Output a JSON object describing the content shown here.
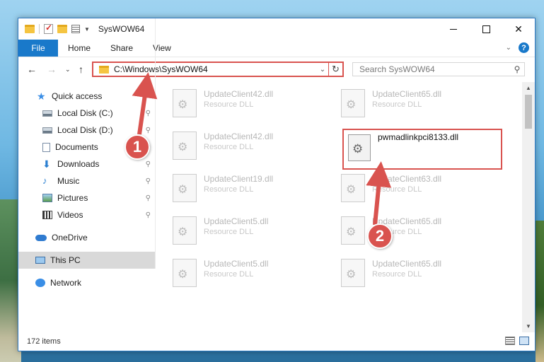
{
  "window": {
    "title": "SysWOW64"
  },
  "ribbon": {
    "file": "File",
    "tabs": [
      "Home",
      "Share",
      "View"
    ]
  },
  "nav": {
    "address": "C:\\Windows\\SysWOW64",
    "search_placeholder": "Search SysWOW64"
  },
  "sidebar": {
    "quick_access": "Quick access",
    "items": [
      {
        "label": "Local Disk (C:)",
        "icon": "drive-icon",
        "pinned": true
      },
      {
        "label": "Local Disk (D:)",
        "icon": "drive-icon",
        "pinned": true
      },
      {
        "label": "Documents",
        "icon": "documents-icon",
        "pinned": true
      },
      {
        "label": "Downloads",
        "icon": "downloads-icon",
        "pinned": true
      },
      {
        "label": "Music",
        "icon": "music-icon",
        "pinned": true
      },
      {
        "label": "Pictures",
        "icon": "pictures-icon",
        "pinned": true
      },
      {
        "label": "Videos",
        "icon": "videos-icon",
        "pinned": true
      }
    ],
    "onedrive": "OneDrive",
    "this_pc": "This PC",
    "network": "Network"
  },
  "files": [
    {
      "name": "UpdateClient42.dll",
      "type": "Resource DLL"
    },
    {
      "name": "UpdateClient65.dll",
      "type": "Resource DLL"
    },
    {
      "name": "UpdateClient42.dll",
      "type": "Resource DLL"
    },
    {
      "name": "UpdateClient19.dll",
      "type": "Resource DLL"
    },
    {
      "name": "UpdateClient63.dll",
      "type": "Resource DLL"
    },
    {
      "name": "UpdateClient5.dll",
      "type": "Resource DLL"
    },
    {
      "name": "UpdateClient65.dll",
      "type": "Resource DLL"
    },
    {
      "name": "UpdateClient5.dll",
      "type": "Resource DLL"
    },
    {
      "name": "UpdateClient65.dll",
      "type": "Resource DLL"
    }
  ],
  "highlighted_file": {
    "name": "pwmadlinkpci8133.dll"
  },
  "status": {
    "item_count": "172 items"
  },
  "annotations": {
    "step1": "1",
    "step2": "2",
    "color": "#d9534f"
  }
}
